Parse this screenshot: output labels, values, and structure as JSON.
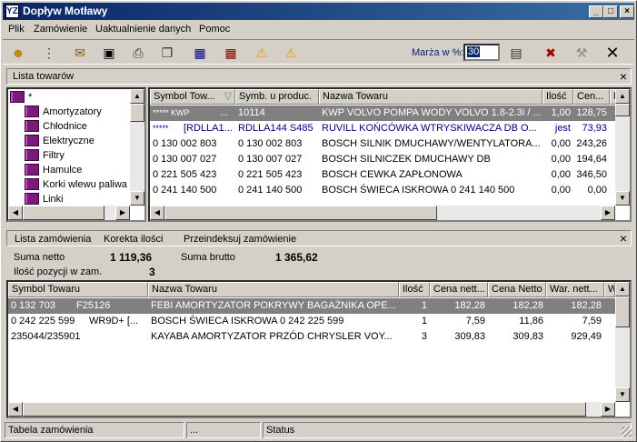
{
  "window": {
    "title": "Dopływ Motławy",
    "app_icon_text": "YZ"
  },
  "menu": [
    "Plik",
    "Zamówienie",
    "Uaktualnienie danych",
    "Pomoc"
  ],
  "toolbar": {
    "marza_label": "Marża w %:",
    "marza_value": "30"
  },
  "towary_panel": {
    "title": "Lista towarów",
    "tree_root": "*",
    "tree_items": [
      "Amortyzatory",
      "Chłodnice",
      "Elektryczne",
      "Filtry",
      "Hamulce",
      "Korki wlewu paliwa",
      "Linki"
    ],
    "columns": [
      "Symbol Tow...",
      "Symb. u produc.",
      "Nazwa Towaru",
      "Ilość",
      "Cen...",
      "M"
    ],
    "rows": [
      {
        "symbol": "***** KWP",
        "dots": "...",
        "symb": "10114",
        "nazwa": "KWP VOLVO POMPA WODY VOLVO 1.8-2.3i / ...",
        "ilosc": "1,00",
        "cena": "128,75"
      },
      {
        "symbol": "*****",
        "dots": "[RDLLA1...",
        "symb": "RDLLA144 S485",
        "nazwa": "RUVILL KOŃCÓWKA WTRYSKIWACZA  DB O...",
        "ilosc": "jest",
        "cena": "73,93"
      },
      {
        "symbol": "0 130 002 803",
        "dots": "",
        "symb": "0 130 002 803",
        "nazwa": "BOSCH SILNIK DMUCHAWY/WENTYLATORA...",
        "ilosc": "0,00",
        "cena": "243,26"
      },
      {
        "symbol": "0 130 007 027",
        "dots": "",
        "symb": "0 130 007 027",
        "nazwa": "BOSCH SILNICZEK DMUCHAWY DB",
        "ilosc": "0,00",
        "cena": "194,64"
      },
      {
        "symbol": "0 221 505 423",
        "dots": "",
        "symb": "0 221 505 423",
        "nazwa": "BOSCH CEWKA ZAPŁONOWA",
        "ilosc": "0,00",
        "cena": "346,50"
      },
      {
        "symbol": "0 241 140 500",
        "dots": "",
        "symb": "0 241 140 500",
        "nazwa": "BOSCH ŚWIECA ISKROWA 0 241 140 500",
        "ilosc": "0,00",
        "cena": "0,00"
      }
    ]
  },
  "zamowienie_panel": {
    "tabs": [
      "Lista zamówienia",
      "Korekta ilości",
      "Przeindeksuj zamówienie"
    ],
    "suma_netto_label": "Suma netto",
    "suma_netto": "1 119,36",
    "suma_brutto_label": "Suma brutto",
    "suma_brutto": "1 365,62",
    "ilosc_label": "Ilość pozycji w zam.",
    "ilosc": "3",
    "columns": [
      "Symbol Towaru",
      "Nazwa Towaru",
      "Ilość",
      "Cena nett...",
      "Cena Netto",
      "War. nett...",
      "W"
    ],
    "rows": [
      {
        "symbol": "0 132 703",
        "extra": "F25126",
        "nazwa": "FEBI AMORTYZATOR POKRYWY BAGAŻNIKA  OPE...",
        "ilosc": "1",
        "cena1": "182,28",
        "cena2": "182,28",
        "war": "182,28"
      },
      {
        "symbol": "0 242 225 599",
        "extra": "WR9D+  [...",
        "nazwa": "BOSCH ŚWIECA ISKROWA 0 242 225 599",
        "ilosc": "1",
        "cena1": "7,59",
        "cena2": "11,86",
        "war": "7,59"
      },
      {
        "symbol": "235044/235901",
        "extra": "",
        "nazwa": "KAYABA AMORTYZATOR PRZÓD  CHRYSLER VOY...",
        "ilosc": "3",
        "cena1": "309,83",
        "cena2": "309,83",
        "war": "929,49"
      }
    ]
  },
  "status": {
    "left": "Tabela zamówienia",
    "middle": "...",
    "right": "Status"
  }
}
